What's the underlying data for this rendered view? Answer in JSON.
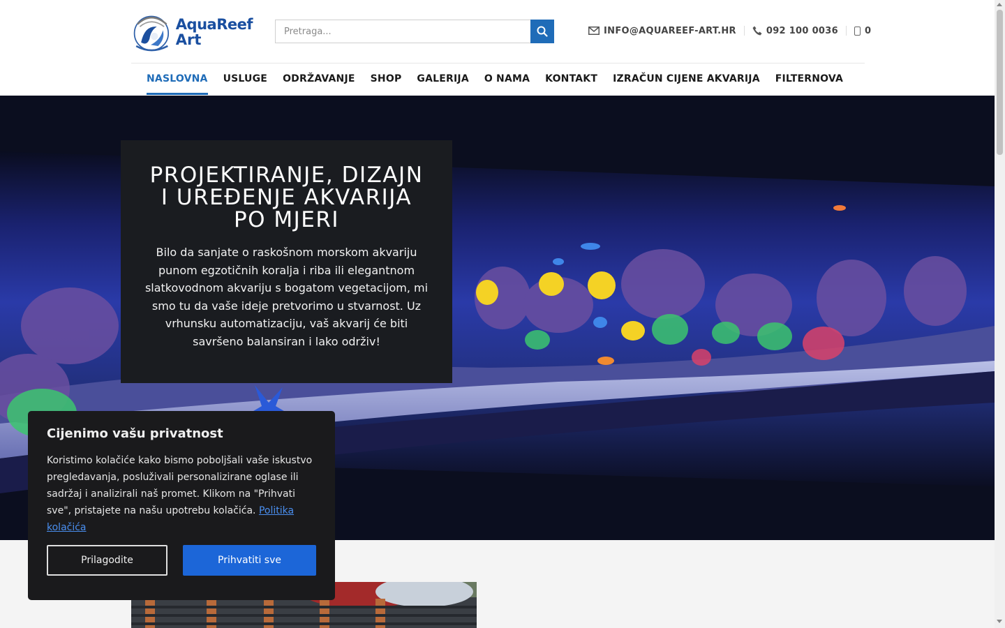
{
  "brand": {
    "line1": "AquaReef",
    "line2": "Art",
    "accent": "#1f6cb8"
  },
  "search": {
    "placeholder": "Pretraga...",
    "icon": "search-icon"
  },
  "contacts": {
    "email": "INFO@AQUAREEF-ART.HR",
    "phone": "092 100 0036",
    "cart_count": "0"
  },
  "nav": {
    "items": [
      {
        "label": "NASLOVNA",
        "active": true
      },
      {
        "label": "USLUGE"
      },
      {
        "label": "ODRŽAVANJE"
      },
      {
        "label": "SHOP"
      },
      {
        "label": "GALERIJA"
      },
      {
        "label": "O NAMA"
      },
      {
        "label": "KONTAKT"
      },
      {
        "label": "IZRAČUN CIJENE AKVARIJA"
      },
      {
        "label": "FILTERNOVA"
      }
    ]
  },
  "hero": {
    "title": "PROJEKTIRANJE, DIZAJN I UREĐENJE AKVARIJA PO MJERI",
    "text": "Bilo da sanjate o raskošnom morskom akvariju punom egzotičnih koralja i riba ili elegantnom slatkovodnom akvariju s bogatom vegetacijom, mi smo tu da vaše ideje pretvorimo u stvarnost. Uz vrhunsku automatizaciju, vaš akvarij će biti savršeno balansiran i lako održiv!"
  },
  "cookie": {
    "title": "Cijenimo vašu privatnost",
    "text": "Koristimo kolačiće kako bismo poboljšali vaše iskustvo pregledavanja, posluživali personalizirane oglase ili sadržaj i analizirali naš promet. Klikom na \"Prihvati sve\", pristajete na našu upotrebu kolačića.",
    "link": "Politika kolačića",
    "customize": "Prilagodite",
    "accept": "Prihvatiti sve"
  }
}
